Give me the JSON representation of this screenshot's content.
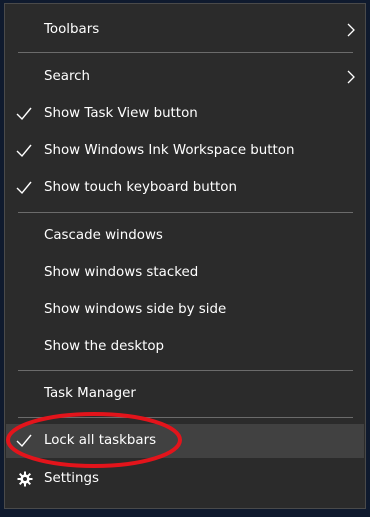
{
  "menu": {
    "toolbars": {
      "label": "Toolbars",
      "has_submenu": true
    },
    "search": {
      "label": "Search",
      "has_submenu": true
    },
    "show_task_view": {
      "label": "Show Task View button",
      "checked": true
    },
    "show_ink_workspace": {
      "label": "Show Windows Ink Workspace button",
      "checked": true
    },
    "show_touch_keyboard": {
      "label": "Show touch keyboard button",
      "checked": true
    },
    "cascade_windows": {
      "label": "Cascade windows"
    },
    "show_windows_stacked": {
      "label": "Show windows stacked"
    },
    "show_windows_side_by_side": {
      "label": "Show windows side by side"
    },
    "show_desktop": {
      "label": "Show the desktop"
    },
    "task_manager": {
      "label": "Task Manager"
    },
    "lock_taskbars": {
      "label": "Lock all taskbars",
      "checked": true,
      "highlighted": true
    },
    "settings": {
      "label": "Settings",
      "icon": "gear-icon"
    }
  },
  "colors": {
    "menu_background": "#2b2b2b",
    "highlight_background": "#414141",
    "text": "#ffffff",
    "separator": "#6b6b6b",
    "annotation_ellipse": "#e3141b"
  }
}
